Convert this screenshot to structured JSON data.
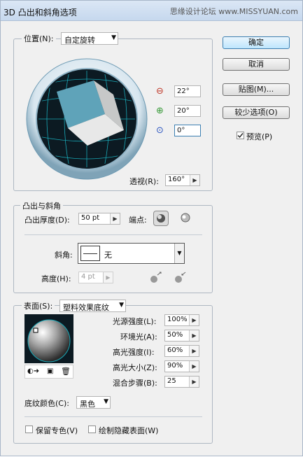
{
  "dialog": {
    "title": "3D 凸出和斜角选项",
    "watermark": "思缘设计论坛 www.MISSYUAN.com"
  },
  "buttons": {
    "ok": "确定",
    "cancel": "取消",
    "map": "贴图(M)...",
    "fewer": "较少选项(O)",
    "preview": "预览(P)"
  },
  "position": {
    "label": "位置(N):",
    "value": "自定旋转",
    "x_rot": "22°",
    "y_rot": "20°",
    "z_rot": "0°",
    "perspective_label": "透视(R):",
    "perspective": "160°"
  },
  "extrude": {
    "legend": "凸出与斜角",
    "depth_label": "凸出厚度(D):",
    "depth": "50 pt",
    "cap_label": "端点:",
    "bevel_label": "斜角:",
    "bevel": "无",
    "height_label": "高度(H):",
    "height": "4 pt"
  },
  "surface": {
    "label": "表面(S):",
    "value": "塑料效果底纹",
    "light_intensity_label": "光源强度(L):",
    "light_intensity": "100%",
    "ambient_label": "环境光(A):",
    "ambient": "50%",
    "highlight_intensity_label": "高光强度(I):",
    "highlight_intensity": "60%",
    "highlight_size_label": "高光大小(Z):",
    "highlight_size": "90%",
    "blend_steps_label": "混合步骤(B):",
    "blend_steps": "25",
    "shade_color_label": "底纹颜色(C):",
    "shade_color": "黑色",
    "preserve_spot_label": "保留专色(V)",
    "draw_hidden_label": "绘制隐藏表面(W)"
  },
  "colors": {
    "accent": "#3c7fb1",
    "cube_face": "#5fa3b9",
    "grid": "#19a7b5"
  },
  "state": {
    "preview_checked": true,
    "preserve_spot_checked": false,
    "draw_hidden_checked": false
  }
}
